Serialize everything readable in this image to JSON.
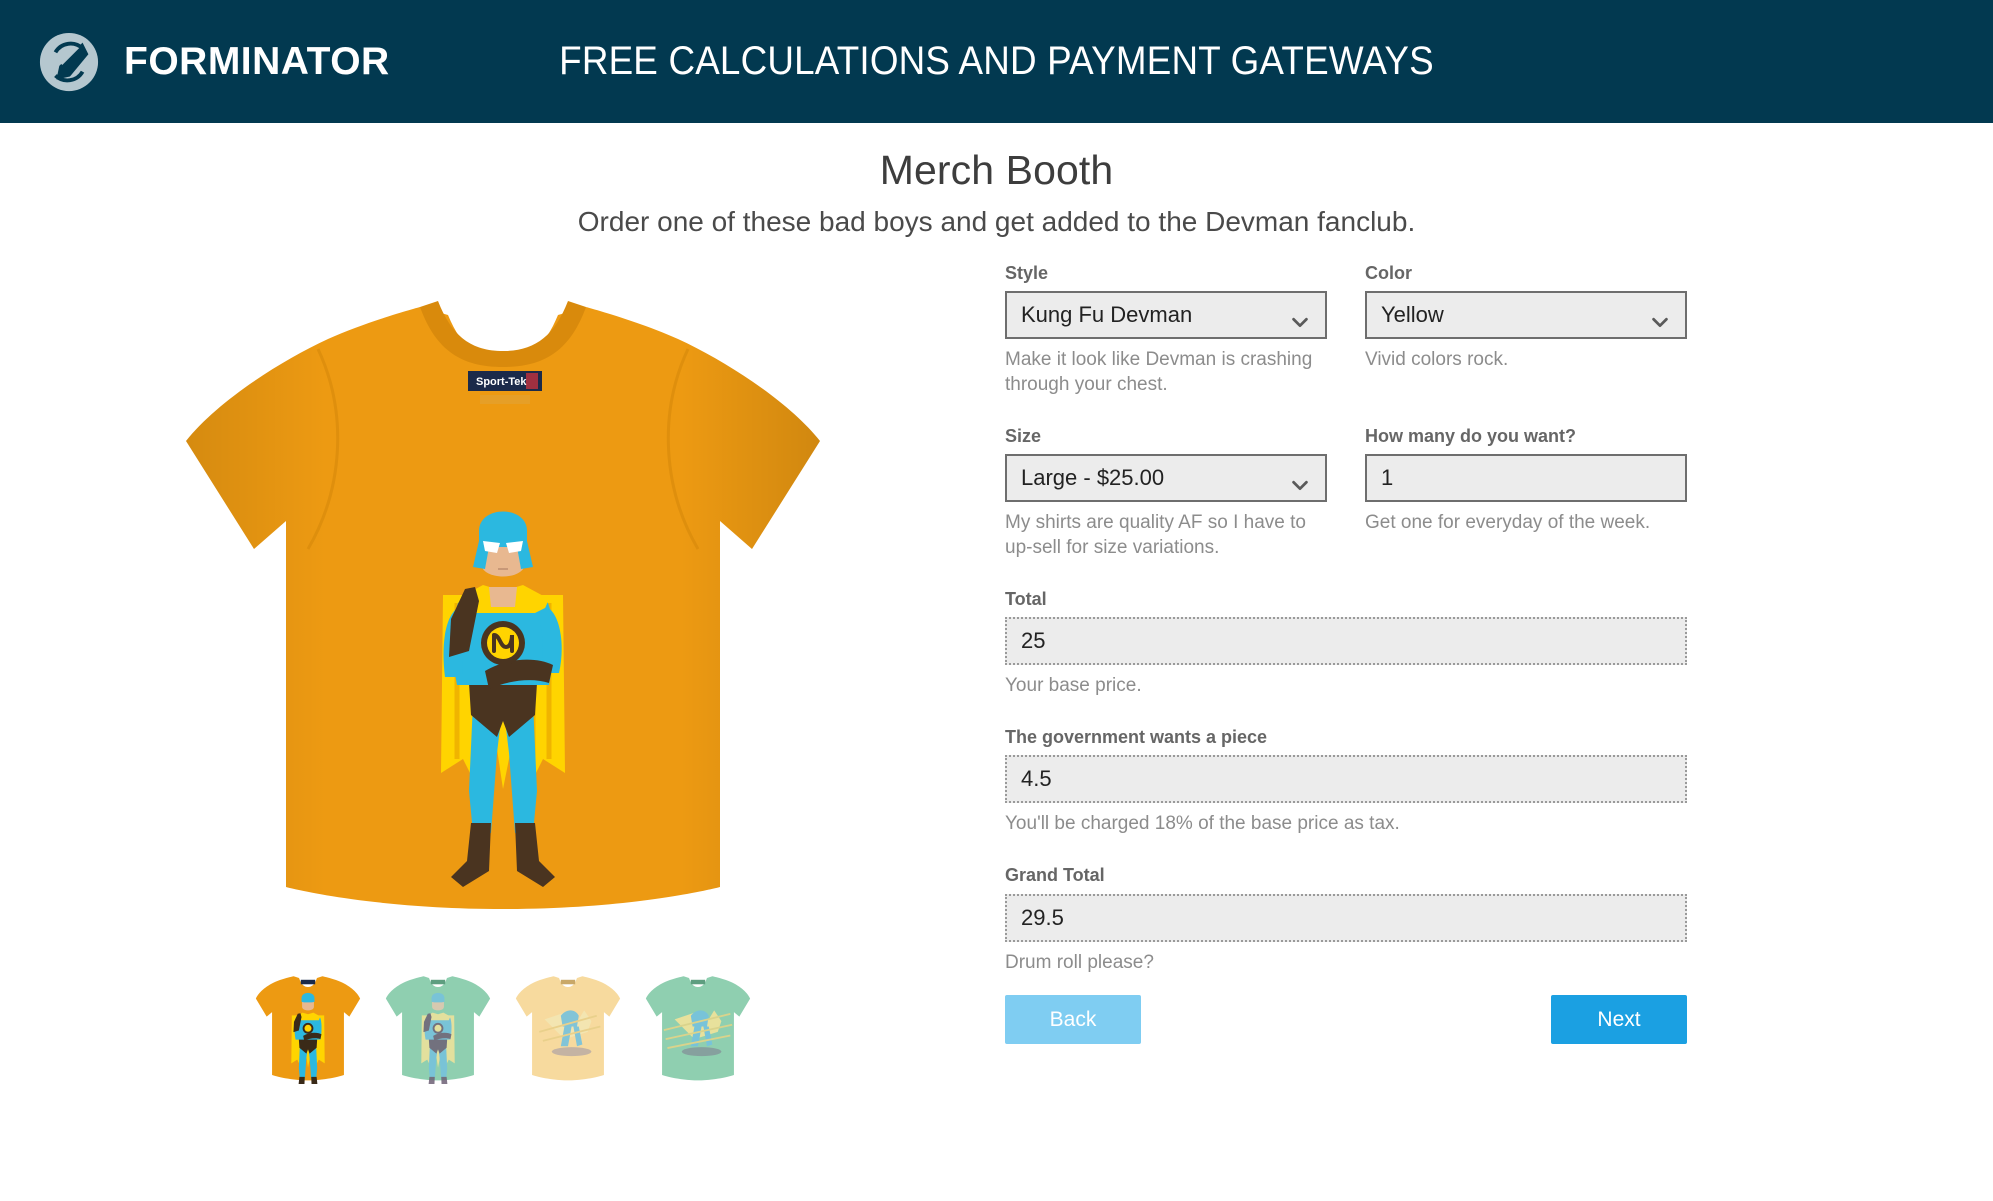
{
  "header": {
    "logo_icon": "forminator-logo-icon",
    "brand_name": "FORMINATOR",
    "tagline": "FREE CALCULATIONS AND PAYMENT GATEWAYS",
    "bg_color": "#023950"
  },
  "page": {
    "title": "Merch Booth",
    "subtitle": "Order one of these bad boys and get added to the Devman fanclub."
  },
  "preview": {
    "shirt_color": "#ED9A12",
    "brand_label": "Sport-Tek",
    "thumbnails": [
      {
        "name": "thumb-orange",
        "shirt_color": "#ED9A12",
        "selected": true
      },
      {
        "name": "thumb-mint-1",
        "shirt_color": "#8FCFB0",
        "selected": false
      },
      {
        "name": "thumb-pale-yellow",
        "shirt_color": "#F7DA9E",
        "selected": false
      },
      {
        "name": "thumb-mint-2",
        "shirt_color": "#8FCFB0",
        "selected": false
      }
    ]
  },
  "form": {
    "style": {
      "label": "Style",
      "value": "Kung Fu Devman",
      "help": "Make it look like Devman is crashing through your chest.",
      "icon": "chevron-down-icon"
    },
    "color": {
      "label": "Color",
      "value": "Yellow",
      "help": "Vivid colors rock.",
      "icon": "chevron-down-icon"
    },
    "size": {
      "label": "Size",
      "value": "Large - $25.00",
      "help": "My shirts are quality AF so I have to up-sell for size variations.",
      "icon": "chevron-down-icon"
    },
    "quantity": {
      "label": "How many do you want?",
      "value": "1",
      "help": "Get one for everyday of the week."
    },
    "total": {
      "label": "Total",
      "value": "25",
      "help": "Your base price."
    },
    "tax": {
      "label": "The government wants a piece",
      "value": "4.5",
      "help": "You'll be charged 18% of the base price as tax."
    },
    "grand_total": {
      "label": "Grand Total",
      "value": "29.5",
      "help": "Drum roll please?"
    }
  },
  "actions": {
    "back_label": "Back",
    "next_label": "Next",
    "back_color": "#7FCDF2",
    "next_color": "#1BA0E2"
  }
}
